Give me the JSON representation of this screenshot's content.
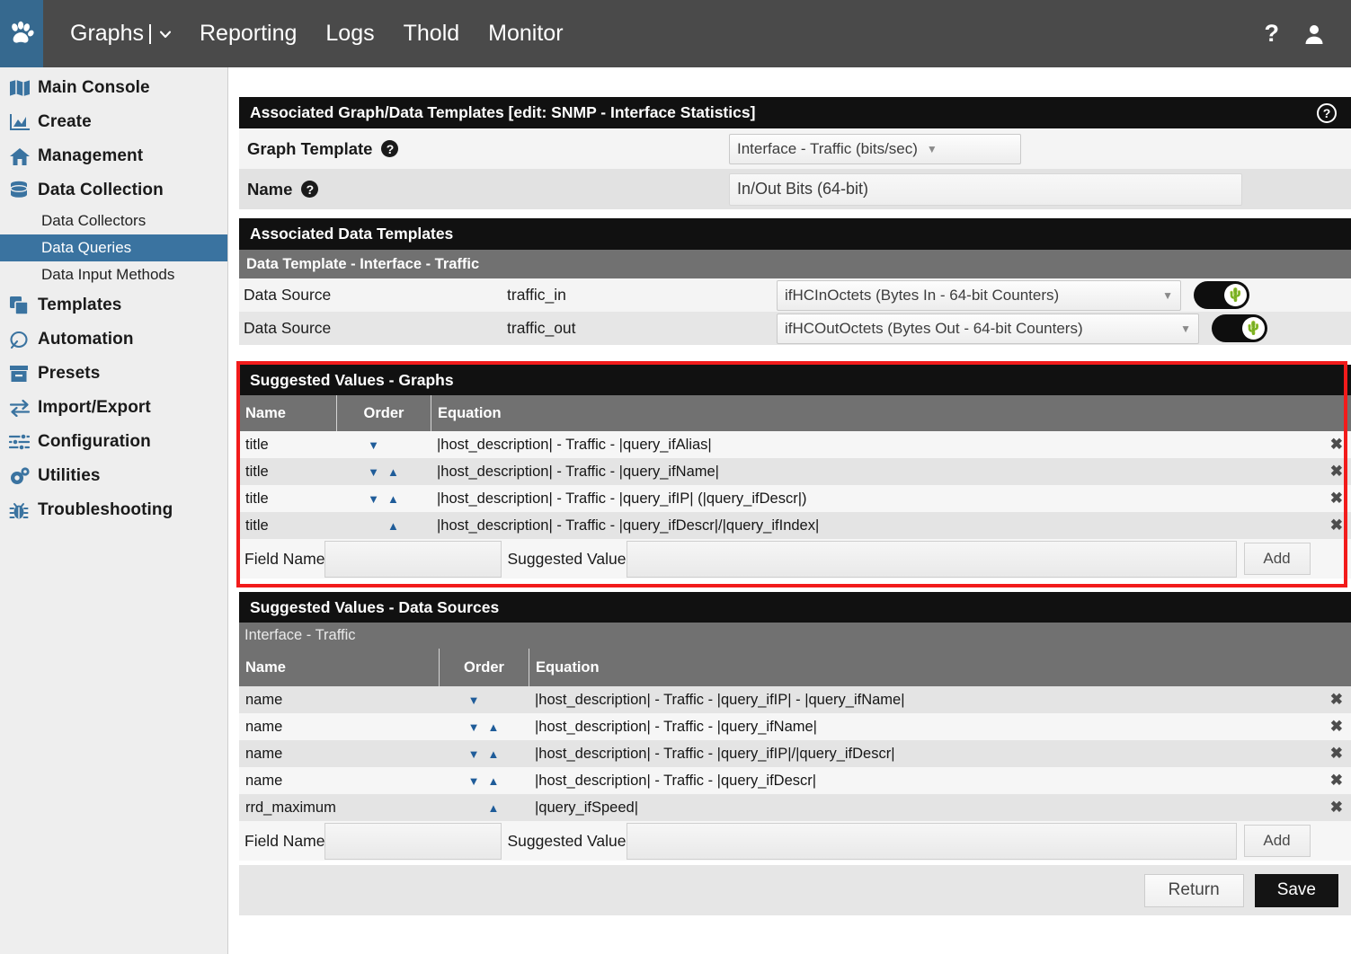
{
  "topbar": {
    "logo_icon": "paw-print-icon",
    "menu": [
      {
        "label": "Graphs",
        "has_caret": true
      },
      {
        "label": "Reporting",
        "has_caret": false
      },
      {
        "label": "Logs",
        "has_caret": false
      },
      {
        "label": "Thold",
        "has_caret": false
      },
      {
        "label": "Monitor",
        "has_caret": false
      }
    ],
    "help_icon": "question-mark-icon",
    "user_icon": "user-account-icon",
    "bg_color": "#4a4a4a",
    "accent_color": "#36698f"
  },
  "sidebar": {
    "items": [
      {
        "label": "Main Console",
        "icon": "map-icon",
        "type": "top"
      },
      {
        "label": "Create",
        "icon": "chart-area-icon",
        "type": "top"
      },
      {
        "label": "Management",
        "icon": "home-icon",
        "type": "top"
      },
      {
        "label": "Data Collection",
        "icon": "database-icon",
        "type": "top"
      },
      {
        "label": "Data Collectors",
        "icon": "",
        "type": "sub",
        "active": false
      },
      {
        "label": "Data Queries",
        "icon": "",
        "type": "sub",
        "active": true
      },
      {
        "label": "Data Input Methods",
        "icon": "",
        "type": "sub",
        "active": false
      },
      {
        "label": "Templates",
        "icon": "copy-icon",
        "type": "top"
      },
      {
        "label": "Automation",
        "icon": "circle-arrow-icon",
        "type": "top"
      },
      {
        "label": "Presets",
        "icon": "archive-box-icon",
        "type": "top"
      },
      {
        "label": "Import/Export",
        "icon": "exchange-arrows-icon",
        "type": "top"
      },
      {
        "label": "Configuration",
        "icon": "sliders-icon",
        "type": "top"
      },
      {
        "label": "Utilities",
        "icon": "gears-icon",
        "type": "top"
      },
      {
        "label": "Troubleshooting",
        "icon": "bug-icon",
        "type": "top"
      }
    ],
    "active_color": "#3a73a0"
  },
  "panel_associated": {
    "title": "Associated Graph/Data Templates [edit: SNMP - Interface Statistics]",
    "help_icon": "circle-question-icon",
    "graph_template_label": "Graph Template",
    "graph_template_value": "Interface - Traffic (bits/sec)",
    "name_label": "Name",
    "name_value": "In/Out Bits (64-bit)"
  },
  "panel_data_templates": {
    "title": "Associated Data Templates",
    "subheader": "Data Template - Interface - Traffic",
    "rows": [
      {
        "label": "Data Source",
        "key": "traffic_in",
        "select": "ifHCInOctets (Bytes In - 64-bit Counters)",
        "toggle_on": true,
        "toggle_icon": "cactus-icon"
      },
      {
        "label": "Data Source",
        "key": "traffic_out",
        "select": "ifHCOutOctets (Bytes Out - 64-bit Counters)",
        "toggle_on": true,
        "toggle_icon": "cactus-icon"
      }
    ]
  },
  "panel_suggested_graphs": {
    "title": "Suggested Values - Graphs",
    "highlighted": true,
    "highlight_color": "#f21b1b",
    "columns": [
      "Name",
      "Order",
      "Equation"
    ],
    "rows": [
      {
        "name": "title",
        "down": true,
        "up": false,
        "equation": "|host_description| - Traffic - |query_ifAlias|",
        "remove_icon": "close-x-icon"
      },
      {
        "name": "title",
        "down": true,
        "up": true,
        "equation": "|host_description| - Traffic - |query_ifName|",
        "remove_icon": "close-x-icon"
      },
      {
        "name": "title",
        "down": true,
        "up": true,
        "equation": "|host_description| - Traffic - |query_ifIP| (|query_ifDescr|)",
        "remove_icon": "close-x-icon"
      },
      {
        "name": "title",
        "down": false,
        "up": true,
        "equation": "|host_description| - Traffic - |query_ifDescr|/|query_ifIndex|",
        "remove_icon": "close-x-icon"
      }
    ],
    "field_name_label": "Field Name",
    "field_name_value": "",
    "suggested_value_label": "Suggested Value",
    "suggested_value_value": "",
    "add_label": "Add"
  },
  "panel_suggested_datasources": {
    "title": "Suggested Values - Data Sources",
    "subheader": "Interface - Traffic",
    "columns": [
      "Name",
      "Order",
      "Equation"
    ],
    "rows": [
      {
        "name": "name",
        "down": true,
        "up": false,
        "equation": "|host_description| - Traffic - |query_ifIP| - |query_ifName|",
        "remove_icon": "close-x-icon"
      },
      {
        "name": "name",
        "down": true,
        "up": true,
        "equation": "|host_description| - Traffic - |query_ifName|",
        "remove_icon": "close-x-icon"
      },
      {
        "name": "name",
        "down": true,
        "up": true,
        "equation": "|host_description| - Traffic - |query_ifIP|/|query_ifDescr|",
        "remove_icon": "close-x-icon"
      },
      {
        "name": "name",
        "down": true,
        "up": true,
        "equation": "|host_description| - Traffic - |query_ifDescr|",
        "remove_icon": "close-x-icon"
      },
      {
        "name": "rrd_maximum",
        "down": false,
        "up": true,
        "equation": "|query_ifSpeed|",
        "remove_icon": "close-x-icon"
      }
    ],
    "field_name_label": "Field Name",
    "field_name_value": "",
    "suggested_value_label": "Suggested Value",
    "suggested_value_value": "",
    "add_label": "Add"
  },
  "footer": {
    "return_label": "Return",
    "save_label": "Save"
  }
}
